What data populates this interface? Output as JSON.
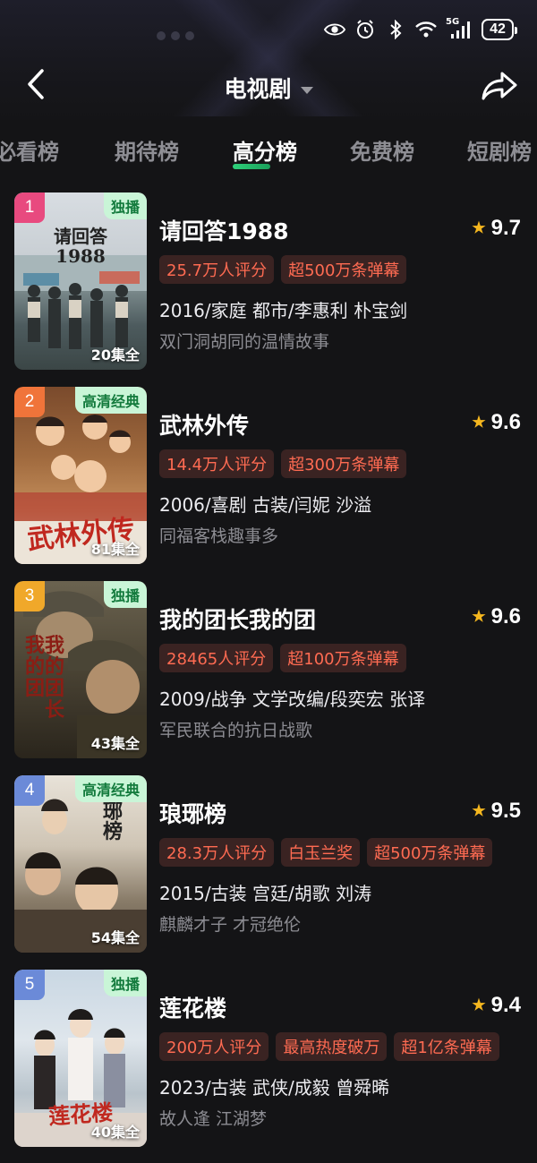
{
  "status_bar": {
    "network": "5G",
    "battery": "42"
  },
  "nav": {
    "title": "电视剧"
  },
  "tabs": [
    {
      "label": "必看榜"
    },
    {
      "label": "期待榜"
    },
    {
      "label": "高分榜"
    },
    {
      "label": "免费榜"
    },
    {
      "label": "短剧榜"
    }
  ],
  "active_tab": "高分榜",
  "colors": {
    "accent_green": "#2ed07a",
    "tag_text": "#ff6b52",
    "tag_bg": "#3a2322",
    "star": "#f5b71f",
    "rank_1": "#e84a7f",
    "rank_2": "#f0743a",
    "rank_3": "#f0a82a",
    "rank_4": "#6b8ad8",
    "rank_5": "#6b8ad8"
  },
  "items": [
    {
      "rank": "1",
      "badge": "独播",
      "poster_text": "请回答\n1988",
      "episodes": "20集全",
      "title": "请回答1988",
      "score": "9.7",
      "tags": [
        "25.7万人评分",
        "超500万条弹幕"
      ],
      "meta": "2016/家庭 都市/李惠利 朴宝剑",
      "desc": "双门洞胡同的温情故事"
    },
    {
      "rank": "2",
      "badge": "高清经典",
      "poster_text": "武林外传",
      "episodes": "81集全",
      "title": "武林外传",
      "score": "9.6",
      "tags": [
        "14.4万人评分",
        "超300万条弹幕"
      ],
      "meta": "2006/喜剧 古装/闫妮 沙溢",
      "desc": "同福客栈趣事多"
    },
    {
      "rank": "3",
      "badge": "独播",
      "poster_text": "我的团长我的团",
      "episodes": "43集全",
      "title": "我的团长我的团",
      "score": "9.6",
      "tags": [
        "28465人评分",
        "超100万条弹幕"
      ],
      "meta": "2009/战争 文学改编/段奕宏 张译",
      "desc": "军民联合的抗日战歌"
    },
    {
      "rank": "4",
      "badge": "高清经典",
      "poster_text": "琅琊榜",
      "episodes": "54集全",
      "title": "琅琊榜",
      "score": "9.5",
      "tags": [
        "28.3万人评分",
        "白玉兰奖",
        "超500万条弹幕"
      ],
      "meta": "2015/古装 宫廷/胡歌 刘涛",
      "desc": "麒麟才子 才冠绝伦"
    },
    {
      "rank": "5",
      "badge": "独播",
      "poster_text": "莲花楼",
      "episodes": "40集全",
      "title": "莲花楼",
      "score": "9.4",
      "tags": [
        "200万人评分",
        "最高热度破万",
        "超1亿条弹幕"
      ],
      "meta": "2023/古装 武侠/成毅 曾舜晞",
      "desc": "故人逢 江湖梦"
    }
  ]
}
